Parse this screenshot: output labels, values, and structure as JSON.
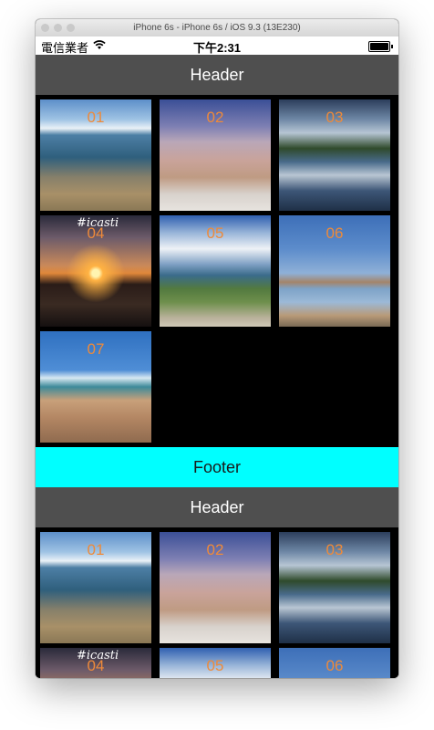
{
  "window": {
    "title": "iPhone 6s - iPhone 6s / iOS 9.3 (13E230)"
  },
  "status_bar": {
    "carrier": "電信業者",
    "wifi_icon": "wifi-icon",
    "time": "下午2:31",
    "battery_icon": "battery-icon",
    "battery_level": 1.0
  },
  "sections": [
    {
      "header": "Header",
      "items": [
        "01",
        "02",
        "03",
        "04",
        "05",
        "06",
        "07"
      ],
      "footer": "Footer"
    },
    {
      "header": "Header",
      "items": [
        "01",
        "02",
        "03",
        "04",
        "05",
        "06"
      ]
    }
  ],
  "watermark_text": "#icasti",
  "colors": {
    "header_bg": "#4f4f4f",
    "footer_bg": "#00ffff",
    "item_number": "#ee8a3a",
    "background": "#000000"
  }
}
